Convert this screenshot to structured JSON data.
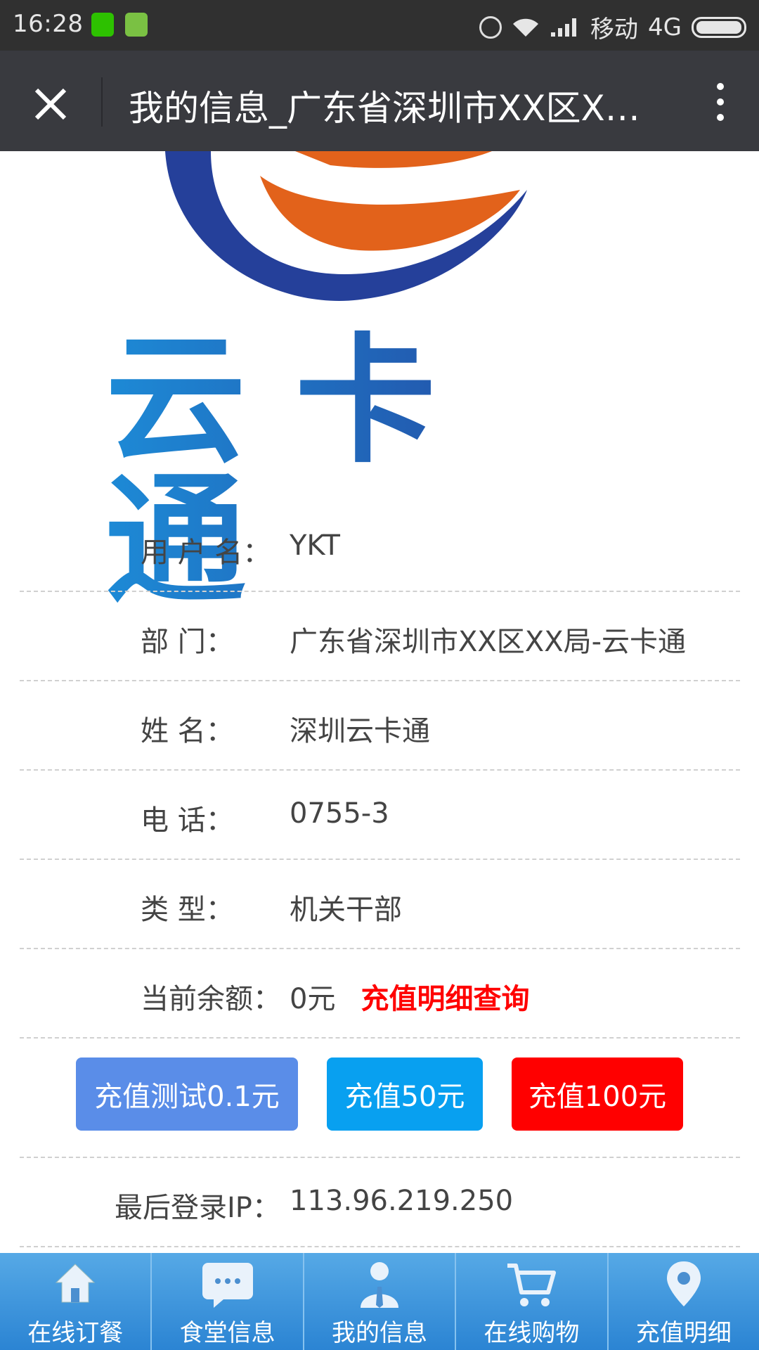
{
  "status_bar": {
    "time": "16:28",
    "carrier": "移动",
    "network": "4G"
  },
  "title_bar": {
    "title": "我的信息_广东省深圳市XX区XX局-云卡通",
    "close_icon": "close-icon",
    "more_icon": "more-vertical-icon"
  },
  "brand": {
    "name": "云卡通",
    "colors": {
      "blue": "#25409a",
      "orange": "#e2621b"
    }
  },
  "info": {
    "username": {
      "label": "用 户 名：",
      "value": "YKT"
    },
    "department": {
      "label": "部       门：",
      "value": "广东省深圳市XX区XX局-云卡通"
    },
    "name": {
      "label": "姓       名：",
      "value": "深圳云卡通"
    },
    "phone": {
      "label": "电       话：",
      "value": "0755-3"
    },
    "type": {
      "label": "类       型：",
      "value": "机关干部"
    },
    "balance": {
      "label": "当前余额：",
      "value": "0元",
      "link": "充值明细查询"
    },
    "last_ip": {
      "label": "最后登录IP：",
      "value": "113.96.219.250"
    }
  },
  "recharge_buttons": {
    "test": "充值测试0.1元",
    "fifty": "充值50元",
    "hundred": "充值100元"
  },
  "bottom_nav": {
    "items": [
      {
        "label": "在线订餐",
        "icon": "home-icon"
      },
      {
        "label": "食堂信息",
        "icon": "chat-bubble-icon"
      },
      {
        "label": "我的信息",
        "icon": "user-icon"
      },
      {
        "label": "在线购物",
        "icon": "cart-icon"
      },
      {
        "label": "充值明细",
        "icon": "location-pin-icon"
      }
    ]
  }
}
